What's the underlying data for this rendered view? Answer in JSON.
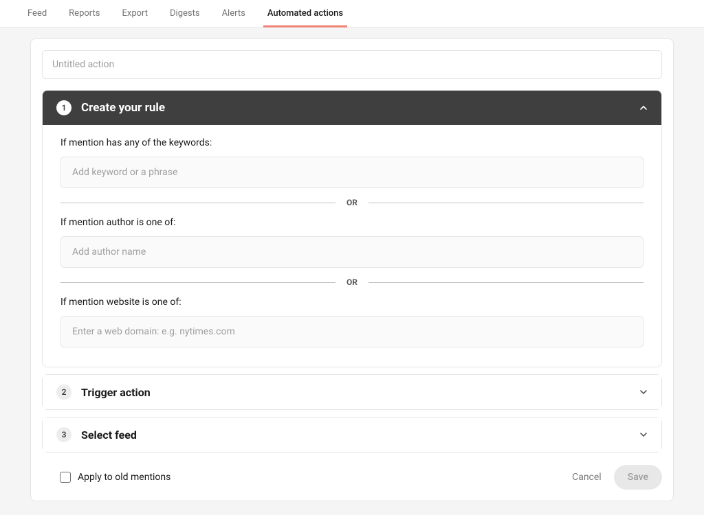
{
  "nav": {
    "tabs": [
      {
        "label": "Feed",
        "active": false
      },
      {
        "label": "Reports",
        "active": false
      },
      {
        "label": "Export",
        "active": false
      },
      {
        "label": "Digests",
        "active": false
      },
      {
        "label": "Alerts",
        "active": false
      },
      {
        "label": "Automated actions",
        "active": true
      }
    ]
  },
  "action_name": {
    "placeholder": "Untitled action",
    "value": ""
  },
  "step1": {
    "number": "1",
    "title": "Create your rule",
    "keywords": {
      "label": "If mention has any of the keywords:",
      "placeholder": "Add keyword or a phrase"
    },
    "author": {
      "label": "If mention author is one of:",
      "placeholder": "Add author name"
    },
    "website": {
      "label": "If mention website is one of:",
      "placeholder": "Enter a web domain: e.g. nytimes.com"
    },
    "separator": "OR"
  },
  "step2": {
    "number": "2",
    "title": "Trigger action"
  },
  "step3": {
    "number": "3",
    "title": "Select feed"
  },
  "footer": {
    "apply_old": "Apply to old mentions",
    "cancel": "Cancel",
    "save": "Save"
  }
}
